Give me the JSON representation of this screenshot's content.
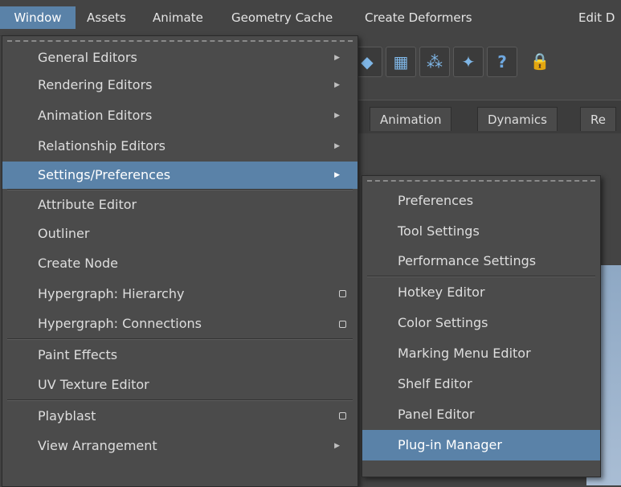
{
  "menubar": {
    "items": [
      "Window",
      "Assets",
      "Animate",
      "Geometry Cache",
      "Create Deformers",
      "Edit D"
    ]
  },
  "shelf": {
    "tabs": [
      "Animation",
      "Dynamics",
      "Re"
    ]
  },
  "window_menu": {
    "items": [
      {
        "label": "General Editors"
      },
      {
        "label": "Rendering Editors"
      },
      {
        "label": "Animation Editors"
      },
      {
        "label": "Relationship Editors"
      },
      {
        "label": "Settings/Preferences"
      },
      {
        "label": "Attribute Editor"
      },
      {
        "label": "Outliner"
      },
      {
        "label": "Create Node"
      },
      {
        "label": "Hypergraph: Hierarchy"
      },
      {
        "label": "Hypergraph: Connections"
      },
      {
        "label": "Paint Effects"
      },
      {
        "label": "UV Texture Editor"
      },
      {
        "label": "Playblast"
      },
      {
        "label": "View Arrangement"
      }
    ]
  },
  "settings_submenu": {
    "items": [
      {
        "label": "Preferences"
      },
      {
        "label": "Tool Settings"
      },
      {
        "label": "Performance Settings"
      },
      {
        "label": "Hotkey Editor"
      },
      {
        "label": "Color Settings"
      },
      {
        "label": "Marking Menu Editor"
      },
      {
        "label": "Shelf Editor"
      },
      {
        "label": "Panel Editor"
      },
      {
        "label": "Plug-in Manager"
      }
    ]
  },
  "colors": {
    "highlight": "#5a82a8",
    "menu_bg": "#4b4b4b",
    "app_bg": "#444444"
  },
  "icons": [
    "submenu-arrow-icon",
    "option-box-icon",
    "tear-off-icon",
    "shelf-tool-icon",
    "help-icon",
    "lock-icon"
  ]
}
